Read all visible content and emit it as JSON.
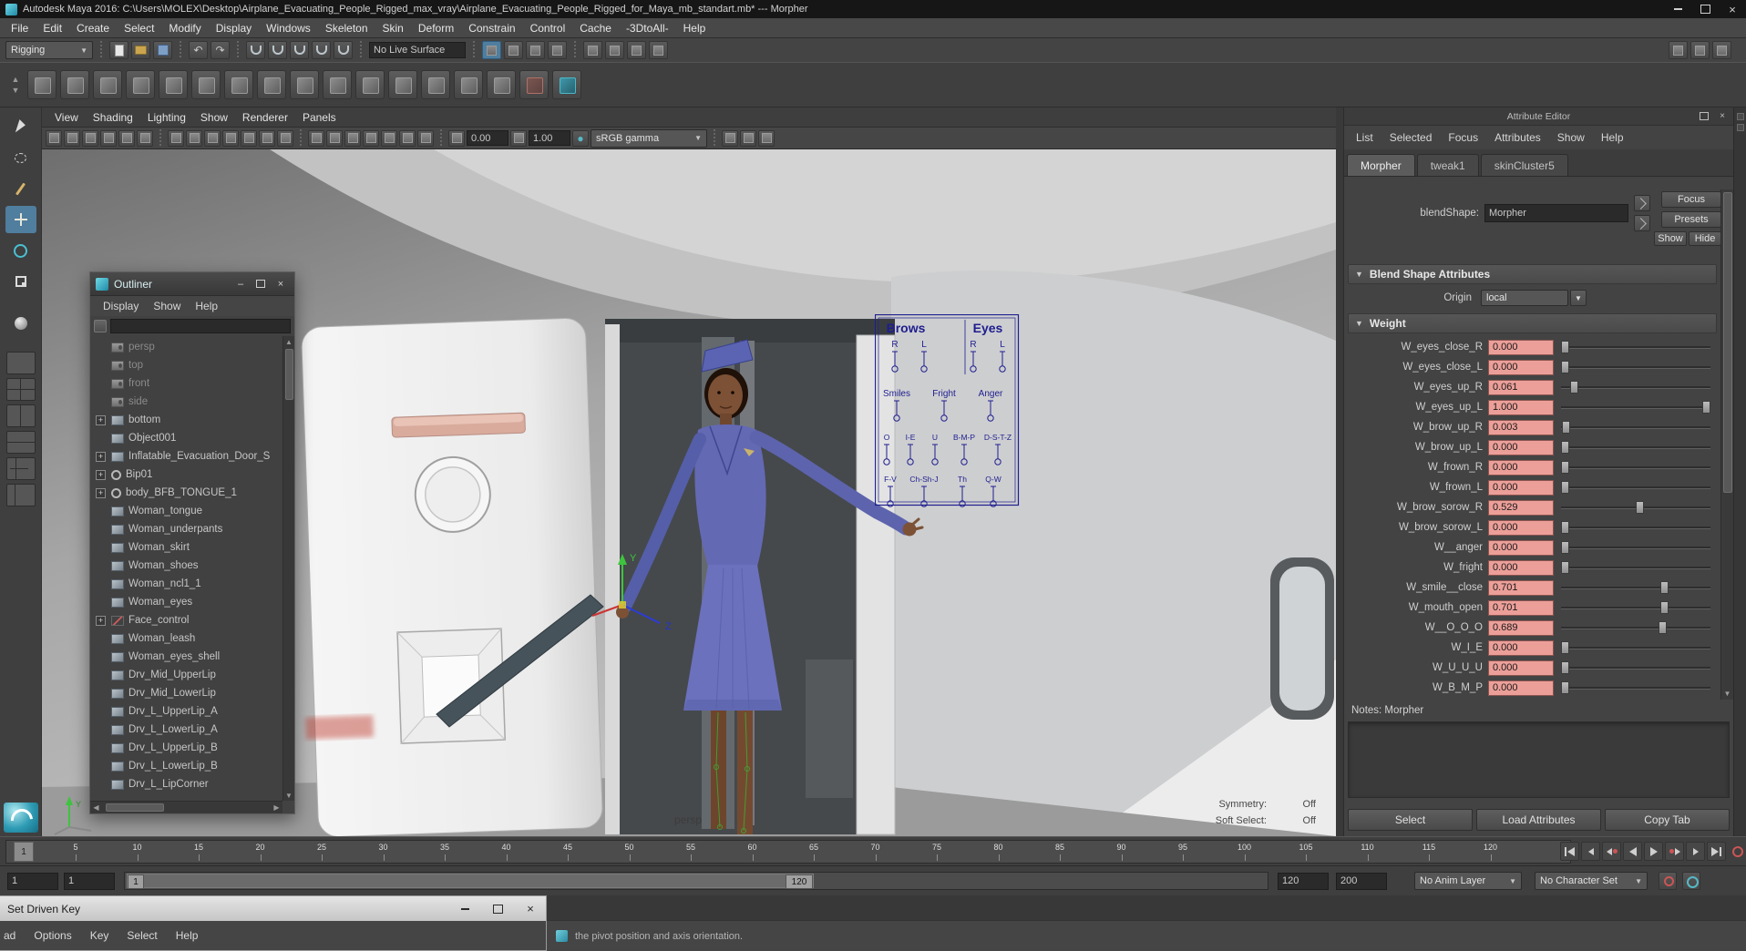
{
  "window": {
    "title": "Autodesk Maya 2016: C:\\Users\\MOLEX\\Desktop\\Airplane_Evacuating_People_Rigged_max_vray\\Airplane_Evacuating_People_Rigged_for_Maya_mb_standart.mb*  ---  Morpher"
  },
  "colors": {
    "accent_teal": "#4db8c8",
    "control_navy": "#1e1e8f",
    "slider_pink": "#ec9f99",
    "active_blue": "#4f7e9e"
  },
  "menubar": {
    "items": [
      "File",
      "Edit",
      "Create",
      "Select",
      "Modify",
      "Display",
      "Windows",
      "Skeleton",
      "Skin",
      "Deform",
      "Constrain",
      "Control",
      "Cache",
      "-3DtoAll-",
      "Help"
    ]
  },
  "status_line": {
    "menuset": "Rigging",
    "file_icons": [
      "file-new-icon",
      "file-open-icon",
      "file-save-icon"
    ],
    "undo_icons": [
      "undo-icon",
      "redo-icon"
    ],
    "snap_icons": [
      "snap-to-grid-icon",
      "snap-to-curve-icon",
      "snap-to-point-icon",
      "snap-to-view-plane-icon",
      "make-live-icon"
    ],
    "no_live_surface": "No Live Surface",
    "mask_icons": [
      "highlight-selection-icon",
      "selection-mask-hierarchy-icon",
      "selection-mask-object-icon",
      "selection-mask-component-icon"
    ],
    "render_icons": [
      "construction-history-icon",
      "render-icon",
      "ipr-render-icon",
      "render-settings-icon"
    ],
    "dock_icons": [
      "attribute-editor-toggle-icon",
      "tool-settings-toggle-icon",
      "channel-box-toggle-icon"
    ]
  },
  "shelf": {
    "icons": [
      "joint-tool-icon",
      "ik-handle-icon",
      "spline-ik-icon",
      "ik-spring-icon",
      "constraint-parent-icon",
      "constraint-point-icon",
      "constraint-orient-icon",
      "constraint-aim-icon",
      "skin-bind-icon",
      "paint-skin-weights-icon",
      "blend-shape-icon",
      "cluster-deformer-icon",
      "lattice-deformer-icon",
      "wrap-deformer-icon",
      "set-driven-key-icon",
      "red-plus-icon",
      "character-set-icon"
    ]
  },
  "toolbox": {
    "tools": [
      "select-tool-icon",
      "lasso-tool-icon",
      "paint-select-tool-icon",
      "move-tool-icon",
      "rotate-tool-icon",
      "scale-tool-icon"
    ],
    "active_index": 3,
    "extra_tool": "last-tool-icon",
    "layouts": [
      "single-pane-layout-icon",
      "four-pane-layout-icon",
      "two-pane-side-layout-icon",
      "two-pane-stacked-layout-icon",
      "three-pane-layout-icon",
      "outliner-persp-layout-icon"
    ]
  },
  "viewport": {
    "menus": [
      "View",
      "Shading",
      "Lighting",
      "Show",
      "Renderer",
      "Panels"
    ],
    "toolbar_icons_a": [
      "select-camera-icon",
      "camera-attributes-icon",
      "bookmark-icon",
      "image-plane-icon",
      "2d-pan-zoom-icon",
      "oversampling-icon"
    ],
    "toolbar_icons_b": [
      "grid-icon",
      "film-gate-icon",
      "resolution-gate-icon",
      "gate-mask-icon",
      "field-chart-icon",
      "safe-action-icon",
      "safe-title-icon"
    ],
    "toolbar_icons_c": [
      "wireframe-icon",
      "shaded-icon",
      "textured-icon",
      "use-all-lights-icon",
      "shadows-icon",
      "screen-space-ao-icon",
      "motion-blur-icon"
    ],
    "toolbar_icons_d": [
      "isolate-select-icon",
      "xray-icon",
      "joints-xray-icon"
    ],
    "exposure": "0.00",
    "gamma": "1.00",
    "color_space": "sRGB gamma",
    "camera": "persp",
    "hud": {
      "symmetry_label": "Symmetry:",
      "symmetry_value": "Off",
      "soft_select_label": "Soft Select:",
      "soft_select_value": "Off"
    }
  },
  "outliner": {
    "title": "Outliner",
    "menus": [
      "Display",
      "Show",
      "Help"
    ],
    "filter_value": "",
    "items": [
      {
        "label": "persp",
        "type": "camera",
        "dim": true
      },
      {
        "label": "top",
        "type": "camera",
        "dim": true
      },
      {
        "label": "front",
        "type": "camera",
        "dim": true
      },
      {
        "label": "side",
        "type": "camera",
        "dim": true
      },
      {
        "label": "bottom",
        "type": "mesh",
        "plus": true
      },
      {
        "label": "Object001",
        "type": "mesh"
      },
      {
        "label": "Inflatable_Evacuation_Door_S",
        "type": "mesh",
        "plus": true
      },
      {
        "label": "Bip01",
        "type": "joint",
        "plus": true
      },
      {
        "label": "body_BFB_TONGUE_1",
        "type": "joint",
        "plus": true
      },
      {
        "label": "Woman_tongue",
        "type": "mesh"
      },
      {
        "label": "Woman_underpants",
        "type": "mesh"
      },
      {
        "label": "Woman_skirt",
        "type": "mesh"
      },
      {
        "label": "Woman_shoes",
        "type": "mesh"
      },
      {
        "label": "Woman_ncl1_1",
        "type": "mesh"
      },
      {
        "label": "Woman_eyes",
        "type": "mesh"
      },
      {
        "label": "Face_control",
        "type": "curve",
        "plus": true
      },
      {
        "label": "Woman_leash",
        "type": "mesh"
      },
      {
        "label": "Woman_eyes_shell",
        "type": "mesh"
      },
      {
        "label": "Drv_Mid_UpperLip",
        "type": "mesh"
      },
      {
        "label": "Drv_Mid_LowerLip",
        "type": "mesh"
      },
      {
        "label": "Drv_L_UpperLip_A",
        "type": "mesh"
      },
      {
        "label": "Drv_L_LowerLip_A",
        "type": "mesh"
      },
      {
        "label": "Drv_L_UpperLip_B",
        "type": "mesh"
      },
      {
        "label": "Drv_L_LowerLip_B",
        "type": "mesh"
      },
      {
        "label": "Drv_L_LipCorner",
        "type": "mesh"
      }
    ]
  },
  "face_control": {
    "headers": [
      "Brows",
      "Eyes"
    ],
    "rows": [
      [
        "R",
        "L",
        "R",
        "L"
      ],
      [
        "Smiles",
        "Fright",
        "Anger"
      ],
      [
        "O",
        "I-E",
        "U",
        "B-M-P",
        "D-S-T-Z"
      ],
      [
        "F-V",
        "Ch-Sh-J",
        "Th",
        "Q-W"
      ]
    ]
  },
  "attribute_editor": {
    "panel_title": "Attribute Editor",
    "menus": [
      "List",
      "Selected",
      "Focus",
      "Attributes",
      "Show",
      "Help"
    ],
    "tabs": [
      "Morpher",
      "tweak1",
      "skinCluster5"
    ],
    "blendshape_label": "blendShape:",
    "blendshape_value": "Morpher",
    "focus_btn": "Focus",
    "presets_btn": "Presets",
    "show_btn": "Show",
    "hide_btn": "Hide",
    "section_blend": "Blend Shape Attributes",
    "origin_label": "Origin",
    "origin_value": "local",
    "section_weight": "Weight",
    "weights": [
      {
        "name": "W_eyes_close_R",
        "value": "0.000"
      },
      {
        "name": "W_eyes_close_L",
        "value": "0.000"
      },
      {
        "name": "W_eyes_up_R",
        "value": "0.061"
      },
      {
        "name": "W_eyes_up_L",
        "value": "1.000"
      },
      {
        "name": "W_brow_up_R",
        "value": "0.003"
      },
      {
        "name": "W_brow_up_L",
        "value": "0.000"
      },
      {
        "name": "W_frown_R",
        "value": "0.000"
      },
      {
        "name": "W_frown_L",
        "value": "0.000"
      },
      {
        "name": "W_brow_sorow_R",
        "value": "0.529"
      },
      {
        "name": "W_brow_sorow_L",
        "value": "0.000"
      },
      {
        "name": "W__anger",
        "value": "0.000"
      },
      {
        "name": "W_fright",
        "value": "0.000"
      },
      {
        "name": "W_smile__close",
        "value": "0.701"
      },
      {
        "name": "W_mouth_open",
        "value": "0.701"
      },
      {
        "name": "W__O_O_O",
        "value": "0.689"
      },
      {
        "name": "W_I_E",
        "value": "0.000"
      },
      {
        "name": "W_U_U_U",
        "value": "0.000"
      },
      {
        "name": "W_B_M_P",
        "value": "0.000"
      }
    ],
    "notes": "Notes: Morpher",
    "buttons": [
      "Select",
      "Load Attributes",
      "Copy Tab"
    ]
  },
  "timeline": {
    "current": "1",
    "ticks": [
      "5",
      "10",
      "15",
      "20",
      "25",
      "30",
      "35",
      "40",
      "45",
      "50",
      "55",
      "60",
      "65",
      "70",
      "75",
      "80",
      "85",
      "90",
      "95",
      "100",
      "105",
      "110",
      "115",
      "120"
    ],
    "playback": [
      "go-start-icon",
      "step-back-icon",
      "prev-key-icon",
      "play-backward-icon",
      "play-forward-icon",
      "next-key-icon",
      "step-forward-icon",
      "go-end-icon"
    ]
  },
  "range_slider": {
    "anim_start": "1",
    "playback_start": "1",
    "range_start": "1",
    "range_end": "120",
    "playback_end": "120",
    "anim_end": "200",
    "anim_layer": "No Anim Layer",
    "character_set": "No Character Set"
  },
  "sdk_window": {
    "title": "Set Driven Key",
    "menus": [
      "ad",
      "Options",
      "Key",
      "Select",
      "Help"
    ]
  },
  "help_bar": {
    "text": "the pivot position and axis orientation."
  }
}
